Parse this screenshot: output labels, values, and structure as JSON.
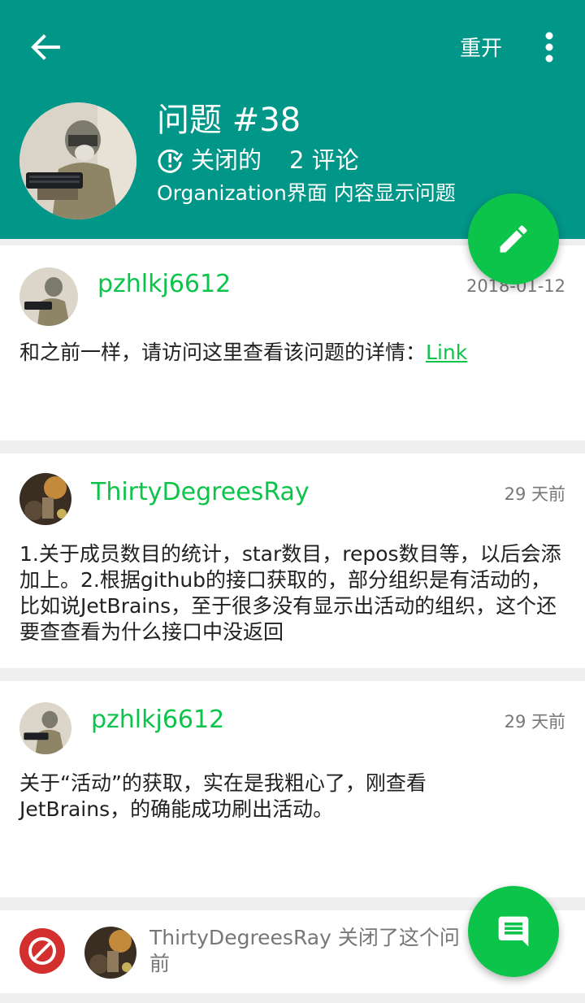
{
  "header": {
    "reopen_label": "重开",
    "issue_title": "问题 #38",
    "status": "关闭的",
    "comment_count": "2 评论",
    "subtitle": "Organization界面 内容显示问题",
    "accent_color": "#009688"
  },
  "comments": [
    {
      "user": "pzhlkj6612",
      "time": "2018-01-12",
      "body_text": "和之前一样，请访问这里查看该问题的详情：",
      "link_text": "Link"
    },
    {
      "user": "ThirtyDegreesRay",
      "time": "29 天前",
      "body_text": "1.关于成员数目的统计，star数目，repos数目等，以后会添加上。2.根据github的接口获取的，部分组织是有活动的，比如说JetBrains，至于很多没有显示出活动的组织，这个还要查查看为什么接口中没返回"
    },
    {
      "user": "pzhlkj6612",
      "time": "29 天前",
      "body_text": "关于“活动”的获取，实在是我粗心了，刚查看JetBrains，的确能成功刷出活动。"
    }
  ],
  "event": {
    "user": "ThirtyDegreesRay",
    "text_line1": "关闭了这个问",
    "text_line2": "前"
  },
  "icons": {
    "back": "arrow-left-icon",
    "more": "more-vert-icon",
    "closed": "issue-closed-icon",
    "edit": "pencil-icon",
    "comment": "comment-icon",
    "event": "block-icon"
  },
  "colors": {
    "fab": "#0cc44a",
    "username": "#0cc44a",
    "event_icon": "#d32f2f"
  }
}
